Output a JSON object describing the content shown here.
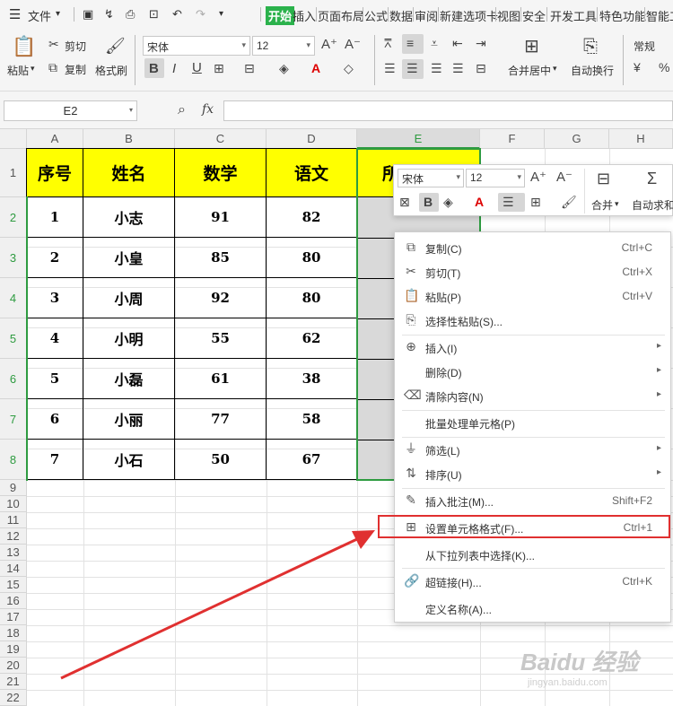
{
  "menubar": {
    "file_label": "文件",
    "tabs": [
      "开始",
      "插入",
      "页面布局",
      "公式",
      "数据",
      "审阅",
      "新建选项卡",
      "视图",
      "安全",
      "开发工具",
      "特色功能",
      "智能工"
    ],
    "active_tab": "开始"
  },
  "ribbon": {
    "paste": "粘贴",
    "cut": "剪切",
    "copy": "复制",
    "format_painter": "格式刷",
    "font_name": "宋体",
    "font_size": "12",
    "merge_center": "合并居中",
    "wrap_text": "自动换行",
    "number_format": "常规"
  },
  "formula_bar": {
    "name_box": "E2",
    "fx": "fx",
    "formula_value": ""
  },
  "sheet": {
    "columns": [
      "A",
      "B",
      "C",
      "D",
      "E",
      "F",
      "G",
      "H"
    ],
    "row_numbers": [
      "1",
      "2",
      "3",
      "4",
      "5",
      "6",
      "7",
      "8",
      "9",
      "10",
      "11",
      "12",
      "13",
      "14",
      "15",
      "16",
      "17",
      "18",
      "19",
      "20",
      "21",
      "22"
    ],
    "header_row": [
      "序号",
      "姓名",
      "数学",
      "语文",
      "所"
    ],
    "rows": [
      [
        "1",
        "小志",
        "91",
        "82"
      ],
      [
        "2",
        "小皇",
        "85",
        "80"
      ],
      [
        "3",
        "小周",
        "92",
        "80"
      ],
      [
        "4",
        "小明",
        "55",
        "62"
      ],
      [
        "5",
        "小磊",
        "61",
        "38"
      ],
      [
        "6",
        "小丽",
        "77",
        "58"
      ],
      [
        "7",
        "小石",
        "50",
        "67"
      ]
    ],
    "header_fill": "#ffff00",
    "selection_color": "#2e9b40"
  },
  "mini_toolbar": {
    "font_name": "宋体",
    "font_size": "12",
    "merge": "合并",
    "autosum": "自动求和"
  },
  "context_menu": {
    "items": [
      {
        "label": "复制(C)",
        "shortcut": "Ctrl+C",
        "icon": "copy-icon"
      },
      {
        "label": "剪切(T)",
        "shortcut": "Ctrl+X",
        "icon": "scissors-icon"
      },
      {
        "label": "粘贴(P)",
        "shortcut": "Ctrl+V",
        "icon": "clipboard-icon"
      },
      {
        "label": "选择性粘贴(S)...",
        "shortcut": "",
        "icon": "paste-special-icon"
      },
      {
        "label": "插入(I)",
        "shortcut": "",
        "icon": "insert-icon",
        "submenu": true
      },
      {
        "label": "删除(D)",
        "shortcut": "",
        "icon": "",
        "submenu": true
      },
      {
        "label": "清除内容(N)",
        "shortcut": "",
        "icon": "eraser-icon",
        "submenu": true
      },
      {
        "label": "批量处理单元格(P)",
        "shortcut": "",
        "icon": ""
      },
      {
        "label": "筛选(L)",
        "shortcut": "",
        "icon": "filter-icon",
        "submenu": true
      },
      {
        "label": "排序(U)",
        "shortcut": "",
        "icon": "sort-icon",
        "submenu": true
      },
      {
        "label": "插入批注(M)...",
        "shortcut": "Shift+F2",
        "icon": "comment-icon"
      },
      {
        "label": "设置单元格格式(F)...",
        "shortcut": "Ctrl+1",
        "icon": "format-cells-icon"
      },
      {
        "label": "从下拉列表中选择(K)...",
        "shortcut": "",
        "icon": ""
      },
      {
        "label": "超链接(H)...",
        "shortcut": "Ctrl+K",
        "icon": "link-icon"
      },
      {
        "label": "定义名称(A)...",
        "shortcut": "",
        "icon": ""
      }
    ],
    "highlighted": "设置单元格格式(F)..."
  },
  "watermark": {
    "brand": "Baidu 经验",
    "url": "jingyan.baidu.com"
  },
  "colors": {
    "accent_green": "#2bb24c",
    "highlight_red": "#e03030"
  }
}
